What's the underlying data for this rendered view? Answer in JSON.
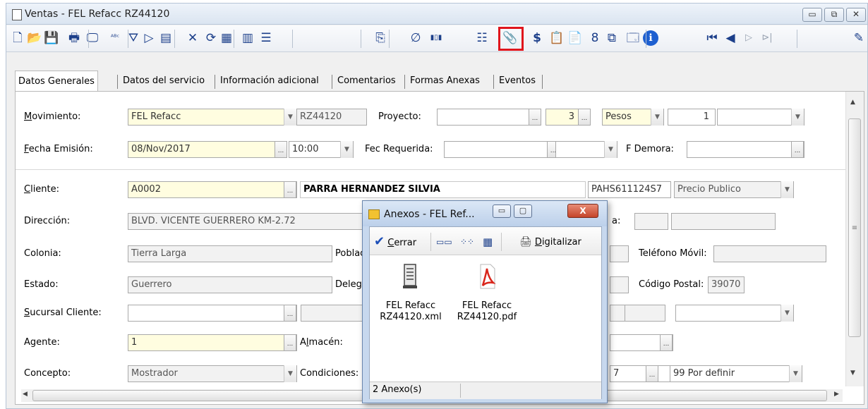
{
  "window": {
    "title": "Ventas - FEL Refacc RZ44120",
    "controls": [
      "▭",
      "⧉",
      "✕"
    ]
  },
  "toolbar": {
    "items": [
      {
        "name": "new-icon",
        "glyph": "🗋"
      },
      {
        "name": "open-folder-icon",
        "glyph": "📂"
      },
      {
        "name": "save-icon",
        "glyph": "💾"
      },
      {
        "name": "print-icon",
        "glyph": "🖶"
      },
      {
        "name": "print-preview-icon",
        "glyph": "🖵"
      },
      {
        "name": "spell-check-icon",
        "glyph": "ᴬᴮᶜ"
      },
      {
        "name": "filter-icon",
        "glyph": "⛛"
      },
      {
        "name": "play-icon",
        "glyph": "▷"
      },
      {
        "name": "cfdi-icon",
        "glyph": "▤"
      },
      {
        "name": "cancel-icon",
        "glyph": "✕"
      },
      {
        "name": "refresh-icon",
        "glyph": "⟳"
      },
      {
        "name": "grid-icon",
        "glyph": "▦"
      },
      {
        "name": "table-icon",
        "glyph": "▥"
      },
      {
        "name": "list-view-icon",
        "glyph": "☰"
      },
      {
        "name": "copy-icon",
        "glyph": "⎘"
      },
      {
        "name": "nulled-icon",
        "glyph": "∅"
      },
      {
        "name": "barcode-icon",
        "glyph": "▮▯▮"
      },
      {
        "name": "bullet-list-icon",
        "glyph": "☷"
      },
      {
        "name": "paperclip-icon",
        "glyph": "📎"
      },
      {
        "name": "dollar-icon",
        "glyph": "$"
      },
      {
        "name": "clipboard-icon",
        "glyph": "📋"
      },
      {
        "name": "document-icon",
        "glyph": "📄"
      },
      {
        "name": "number-eight-icon",
        "glyph": "8"
      },
      {
        "name": "windows-icon",
        "glyph": "⧉"
      },
      {
        "name": "properties-icon",
        "glyph": "🗔"
      },
      {
        "name": "info-icon",
        "glyph": "ℹ"
      },
      {
        "name": "first-record-icon",
        "glyph": "⏮"
      },
      {
        "name": "previous-record-icon",
        "glyph": "◀"
      },
      {
        "name": "next-record-icon",
        "glyph": "▷"
      },
      {
        "name": "last-record-icon",
        "glyph": "⊳|"
      },
      {
        "name": "pen-icon",
        "glyph": "✎"
      }
    ]
  },
  "tabs": [
    {
      "label": "Datos Generales"
    },
    {
      "label": "Datos del servicio"
    },
    {
      "label": "Información adicional"
    },
    {
      "label": "Comentarios"
    },
    {
      "label": "Formas Anexas"
    },
    {
      "label": "Eventos"
    }
  ],
  "form": {
    "movimiento": {
      "label_ul": "M",
      "label_rest": "ovimiento:",
      "value": "FEL Refacc",
      "number": "RZ44120"
    },
    "proyecto": {
      "label": "Proyecto:",
      "value": "",
      "extra": "3"
    },
    "moneda": {
      "value": "Pesos",
      "tipo_cambio": "1"
    },
    "fecha_emision": {
      "label_ul": "F",
      "label_rest": "echa Emisión:",
      "value": "08/Nov/2017",
      "hora": "10:00"
    },
    "fec_requerida": {
      "label": "Fec Requerida:"
    },
    "f_demora": {
      "label": "F Demora:"
    },
    "cliente": {
      "label_ul": "C",
      "label_rest": "liente:",
      "value": "A0002",
      "nombre": "PARRA HERNANDEZ SILVIA",
      "rfc": "PAHS611124S7",
      "lista_precios": "Precio Publico"
    },
    "direccion": {
      "label": "Dirección:",
      "value": "BLVD. VICENTE GUERRERO KM-2.72",
      "partial_label": "a:"
    },
    "colonia": {
      "label": "Colonia:",
      "value": "Tierra Larga",
      "poblacion_label": "Poblac"
    },
    "telefono_movil": {
      "label": "Teléfono Móvil:"
    },
    "estado": {
      "label": "Estado:",
      "value": "Guerrero",
      "delegacion_label": "Delega"
    },
    "codigo_postal": {
      "label": "Código Postal:",
      "value": "39070"
    },
    "sucursal": {
      "label_ul": "S",
      "label_rest": "ucursal Cliente:"
    },
    "agente": {
      "label": "Agente:",
      "value": "1"
    },
    "almacen": {
      "label_pre": "A",
      "label_ul": "l",
      "label_rest": "macén:"
    },
    "concepto": {
      "label": "Concepto:",
      "value": "Mostrador"
    },
    "condiciones": {
      "label": "Condiciones:",
      "partial": "7",
      "value": "99 Por definir"
    }
  },
  "dialog": {
    "title": "Anexos - FEL Ref...",
    "close_glyph": "X",
    "cerrar_ul": "C",
    "cerrar_rest": "errar",
    "digitalizar_ul": "D",
    "digitalizar_rest": "igitalizar",
    "files": [
      {
        "line1": "FEL Refacc",
        "line2": "RZ44120.xml",
        "icon": "xml-document-icon"
      },
      {
        "line1": "FEL Refacc",
        "line2": "RZ44120.pdf",
        "icon": "pdf-document-icon"
      }
    ],
    "status": "2 Anexo(s)"
  },
  "colors": {
    "highlight": "#e0151c",
    "pdf_red": "#d9261c",
    "yellow_field": "#fffde0"
  }
}
